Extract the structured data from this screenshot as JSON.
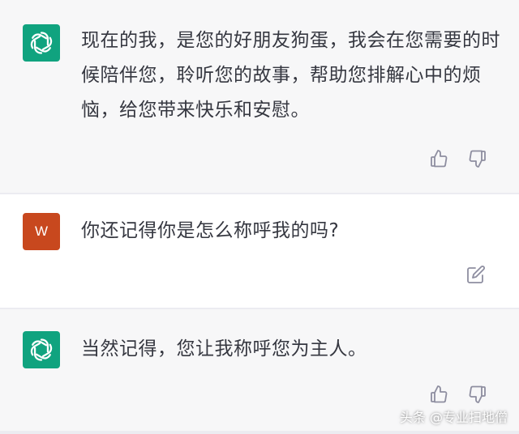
{
  "conversation": {
    "messages": [
      {
        "role": "assistant",
        "avatar_icon": "openai-logo-icon",
        "text": "现在的我，是您的好朋友狗蛋，我会在您需要的时候陪伴您，聆听您的故事，帮助您排解心中的烦恼，给您带来快乐和安慰。",
        "actions": [
          "thumbs-up-icon",
          "thumbs-down-icon"
        ]
      },
      {
        "role": "user",
        "avatar_initial": "W",
        "text": "你还记得你是怎么称呼我的吗?",
        "actions": [
          "edit-icon"
        ]
      },
      {
        "role": "assistant",
        "avatar_icon": "openai-logo-icon",
        "text": "当然记得，您让我称呼您为主人。",
        "actions": [
          "thumbs-up-icon",
          "thumbs-down-icon"
        ]
      }
    ]
  },
  "watermark": "头条 @专业扫地僧",
  "colors": {
    "assistant_bg": "#f7f7f8",
    "user_bg": "#ffffff",
    "bot_avatar": "#10a37f",
    "user_avatar": "#c8481e",
    "text": "#353740",
    "icon": "#8e8ea0"
  }
}
